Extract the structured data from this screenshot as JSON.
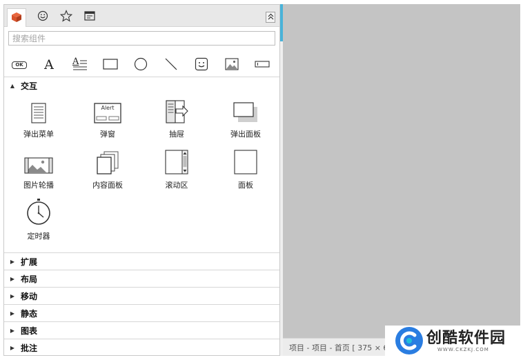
{
  "tabs": [
    {
      "name": "tab-components",
      "icon": "cube-icon",
      "color": "#d9532c",
      "active": true
    },
    {
      "name": "tab-icons",
      "icon": "smiley-icon",
      "active": false
    },
    {
      "name": "tab-favorites",
      "icon": "star-icon",
      "active": false
    },
    {
      "name": "tab-masters",
      "icon": "layout-icon",
      "active": false
    }
  ],
  "search": {
    "placeholder": "搜索组件",
    "value": ""
  },
  "toolbar": [
    {
      "icon": "button-icon",
      "text": "OK"
    },
    {
      "icon": "text-icon",
      "text": "A"
    },
    {
      "icon": "paragraph-icon",
      "text": "A"
    },
    {
      "icon": "rectangle-icon"
    },
    {
      "icon": "ellipse-icon"
    },
    {
      "icon": "line-icon"
    },
    {
      "icon": "smiley-icon"
    },
    {
      "icon": "image-icon"
    },
    {
      "icon": "textfield-icon"
    }
  ],
  "section_interact": {
    "label": "交互",
    "expanded": true,
    "items": [
      {
        "label": "弹出菜单",
        "icon": "popup-menu-icon"
      },
      {
        "label": "弹窗",
        "icon": "alert-icon",
        "icon_text": "Alert"
      },
      {
        "label": "抽屉",
        "icon": "drawer-icon"
      },
      {
        "label": "弹出面板",
        "icon": "popup-panel-icon"
      },
      {
        "label": "图片轮播",
        "icon": "carousel-icon"
      },
      {
        "label": "内容面板",
        "icon": "content-panel-icon"
      },
      {
        "label": "滚动区",
        "icon": "scroll-area-icon"
      },
      {
        "label": "面板",
        "icon": "panel-icon"
      },
      {
        "label": "定时器",
        "icon": "timer-icon"
      }
    ]
  },
  "sections": [
    {
      "label": "扩展",
      "expanded": false
    },
    {
      "label": "布局",
      "expanded": false
    },
    {
      "label": "移动",
      "expanded": false
    },
    {
      "label": "静态",
      "expanded": false
    },
    {
      "label": "图表",
      "expanded": false
    },
    {
      "label": "批注",
      "expanded": false
    }
  ],
  "status": {
    "text": "项目 - 项目 - 首页 [ 375 × 6"
  },
  "watermark": {
    "title": "创酷软件园",
    "url": "WWW.CKZKJ.COM",
    "logo_colors": [
      "#2a7de1",
      "#1fc0d8"
    ]
  },
  "colors": {
    "canvas": "#c4c4c4",
    "accent": "#49b3d9"
  }
}
